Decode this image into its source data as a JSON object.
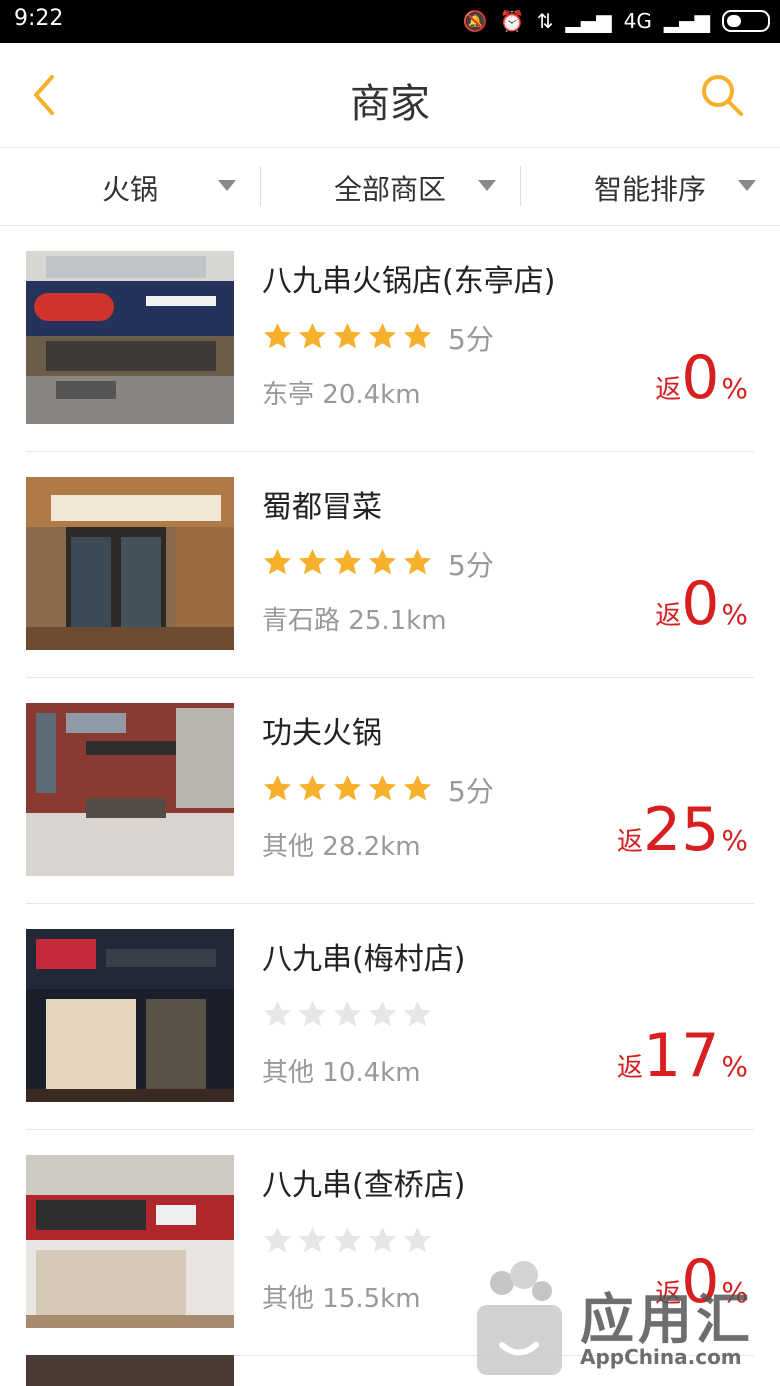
{
  "status_bar": {
    "time": "9:22",
    "network": "4G"
  },
  "header": {
    "title": "商家"
  },
  "filters": [
    {
      "label": "火锅"
    },
    {
      "label": "全部商区"
    },
    {
      "label": "智能排序"
    }
  ],
  "colors": {
    "accent": "#f6b02b",
    "rebate": "#d71f1f",
    "star_empty": "#e6e6e6"
  },
  "stores": [
    {
      "name": "八九串火锅店(东亭店)",
      "rating": 5,
      "score_label": "5分",
      "area": "东亭",
      "distance": "20.4km",
      "rebate_prefix": "返",
      "rebate_value": "0",
      "rebate_suffix": "%"
    },
    {
      "name": "蜀都冒菜",
      "rating": 5,
      "score_label": "5分",
      "area": "青石路",
      "distance": "25.1km",
      "rebate_prefix": "返",
      "rebate_value": "0",
      "rebate_suffix": "%"
    },
    {
      "name": "功夫火锅",
      "rating": 5,
      "score_label": "5分",
      "area": "其他",
      "distance": "28.2km",
      "rebate_prefix": "返",
      "rebate_value": "25",
      "rebate_suffix": "%"
    },
    {
      "name": "八九串(梅村店)",
      "rating": 0,
      "score_label": "",
      "area": "其他",
      "distance": "10.4km",
      "rebate_prefix": "返",
      "rebate_value": "17",
      "rebate_suffix": "%"
    },
    {
      "name": "八九串(查桥店)",
      "rating": 0,
      "score_label": "",
      "area": "其他",
      "distance": "15.5km",
      "rebate_prefix": "返",
      "rebate_value": "0",
      "rebate_suffix": "%"
    }
  ],
  "watermark": {
    "title": "应用汇",
    "subtitle": "AppChina.com"
  }
}
